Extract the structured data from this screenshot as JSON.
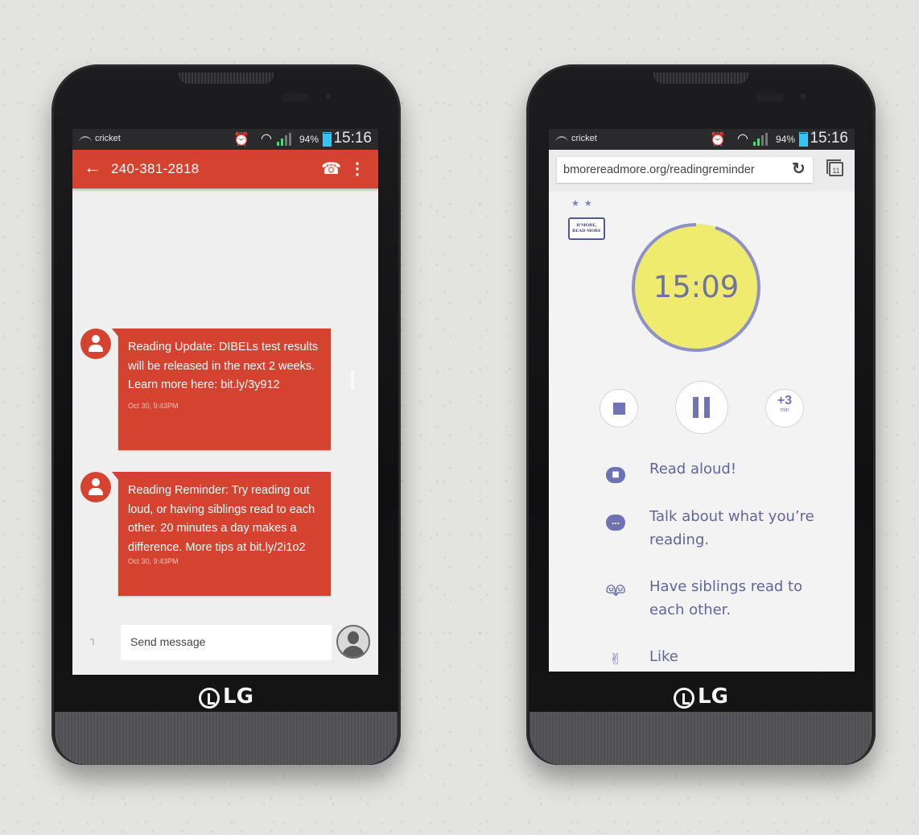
{
  "status_bar": {
    "carrier": "cricket",
    "battery": "94%",
    "battery_level": 0.94,
    "time": "15:16",
    "alarm_icon": "alarm-clock-icon",
    "wifi_icon": "wifi-icon",
    "signal_icon": "cell-signal-icon"
  },
  "sms": {
    "contact": "240-381-2818",
    "back_icon": "arrow-left-icon",
    "call_icon": "phone-icon",
    "menu_icon": "more-vert-icon",
    "messages": [
      {
        "text": "Reading Update: DIBELs test results will be released in the next 2 weeks. Learn more here: bit.ly/3y912",
        "timestamp": "Oct 30, 9:43PM"
      },
      {
        "text": "Reading Reminder: Try reading out loud, or having siblings read to each other. 20 minutes a day makes a difference. More tips at bit.ly/2i1o2",
        "timestamp": "Oct 30, 9:43PM"
      }
    ],
    "composer_placeholder": "Send message",
    "attach_icon": "paperclip-icon",
    "accent_color": "#d54330"
  },
  "browser": {
    "url": "bmorereadmore.org/readingreminder",
    "tab_count": "11",
    "reload_icon": "reload-icon",
    "logo_text": "B'MORE, READ MORE",
    "timer": {
      "display": "15:09",
      "progress": 0.95,
      "face_color": "#eeeb6e",
      "ring_color": "#8e90c8"
    },
    "controls": {
      "stop_icon": "stop-icon",
      "pause_icon": "pause-icon",
      "add_big": "+3",
      "add_small": "min"
    },
    "tips": [
      {
        "icon": "read-aloud-icon",
        "text": "Read aloud!"
      },
      {
        "icon": "talk-bubbles-icon",
        "text": "Talk about what you’re reading."
      },
      {
        "icon": "siblings-icon",
        "text": "Have siblings read to each other."
      },
      {
        "icon": "thumbs-up-icon",
        "text": "Like"
      }
    ],
    "accent_color": "#6e72b3"
  },
  "device": {
    "brand": "LG"
  }
}
